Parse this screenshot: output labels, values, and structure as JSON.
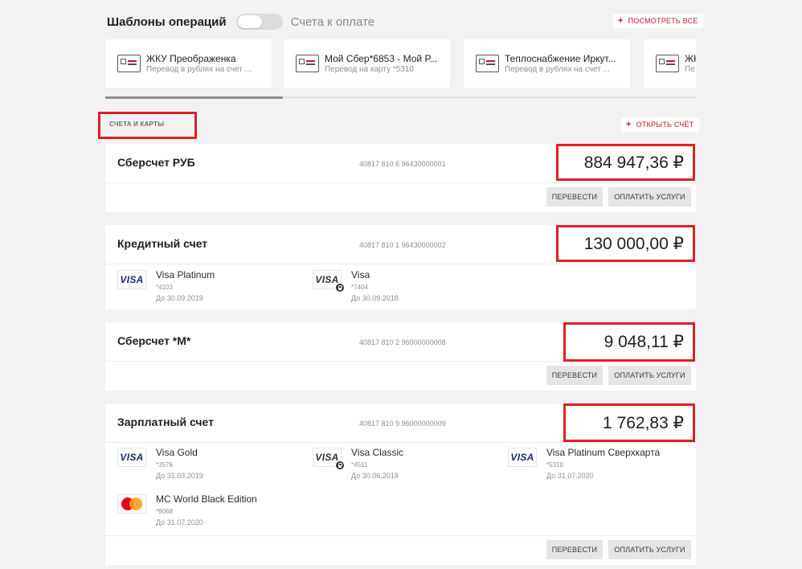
{
  "top_tabs": {
    "templates_label": "Шаблоны операций",
    "bills_label": "Счета к оплате"
  },
  "see_all": {
    "plus": "+",
    "label": "ПОСМОТРЕТЬ ВСЕ"
  },
  "templates": [
    {
      "title": "ЖКУ Преображенка",
      "subtitle": "Перевод в рублях на счет ..."
    },
    {
      "title": "Мой Сбер*6853 - Мой Р...",
      "subtitle": "Перевод на карту *5310"
    },
    {
      "title": "Теплоснабжение Иркут...",
      "subtitle": "Перевод в рублях на счет ..."
    },
    {
      "title": "ЖК",
      "subtitle": "Пе"
    }
  ],
  "templates_scroll": {
    "thumb_fraction": 0.3
  },
  "section": {
    "label": "СЧЕТА И КАРТЫ",
    "open_account_plus": "+",
    "open_account_label": "ОТКРЫТЬ СЧЁТ"
  },
  "actions": {
    "transfer": "ПЕРЕВЕСТИ",
    "pay": "ОПЛАТИТЬ УСЛУГИ"
  },
  "accounts": [
    {
      "name": "Сберсчет РУБ",
      "number": "40817 810 6 96430000001",
      "balance": "884 947,36 ₽",
      "cards": []
    },
    {
      "name": "Кредитный счет",
      "number": "40817 810 1 96430000002",
      "balance": "130 000,00 ₽",
      "cards": [
        {
          "brand": "VISA",
          "title": "Visa Platinum",
          "number": "*4103",
          "expiry": "До 30.09.2019",
          "locked": false
        },
        {
          "brand": "VISA",
          "title": "Visa",
          "number": "*7404",
          "expiry": "До 30.09.2018",
          "locked": true
        }
      ]
    },
    {
      "name": "Сберсчет *М*",
      "number": "40817 810 2 96000000008",
      "balance": "9 048,11 ₽",
      "cards": []
    },
    {
      "name": "Зарплатный счет",
      "number": "40817 810 9 96000000009",
      "balance": "1 762,83 ₽",
      "cards": [
        {
          "brand": "VISA",
          "title": "Visa Gold",
          "number": "*3576",
          "expiry": "До 31.03.2019",
          "locked": false
        },
        {
          "brand": "VISA",
          "title": "Visa Classic",
          "number": "*4511",
          "expiry": "До 30.06.2018",
          "locked": true
        },
        {
          "brand": "VISA",
          "title": "Visa Platinum Сверхкарта",
          "number": "*5310",
          "expiry": "До 31.07.2020",
          "locked": false
        },
        {
          "brand": "MasterCard",
          "title": "MC World Black Edition",
          "number": "*9068",
          "expiry": "До 31.07.2020",
          "locked": false
        }
      ]
    }
  ],
  "colors": {
    "accent_red": "#e31e24",
    "brand_red": "#c8102e",
    "visa_blue": "#1a2b6d"
  },
  "icons": {
    "template": "receipt-card-icon",
    "plus": "plus-icon",
    "lock": "lock-icon",
    "visa": "visa-logo-icon",
    "mastercard": "mastercard-logo-icon"
  }
}
